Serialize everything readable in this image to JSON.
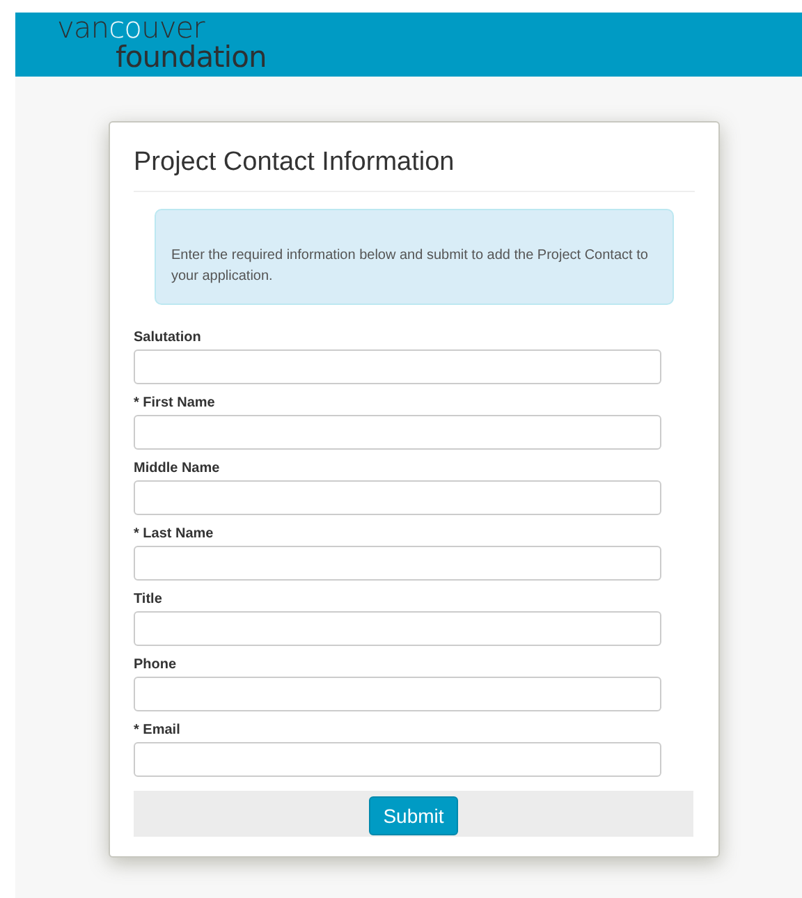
{
  "logo": {
    "line_1_start": "van",
    "line_1_loop": "co",
    "line_1_end": "uver",
    "line_2": "foundation"
  },
  "form": {
    "title": "Project Contact Information",
    "notice": "Enter the required information below and submit to add the Project Contact to your application.",
    "fields": [
      {
        "label": "Salutation"
      },
      {
        "label": "First Name",
        "required_mark": "*"
      },
      {
        "label": "Middle Name"
      },
      {
        "label": "Last Name",
        "required_mark": "*"
      },
      {
        "label": "Title"
      },
      {
        "label": "Phone"
      },
      {
        "label": "Email",
        "required_mark": "*"
      }
    ],
    "submit": "Submit"
  }
}
